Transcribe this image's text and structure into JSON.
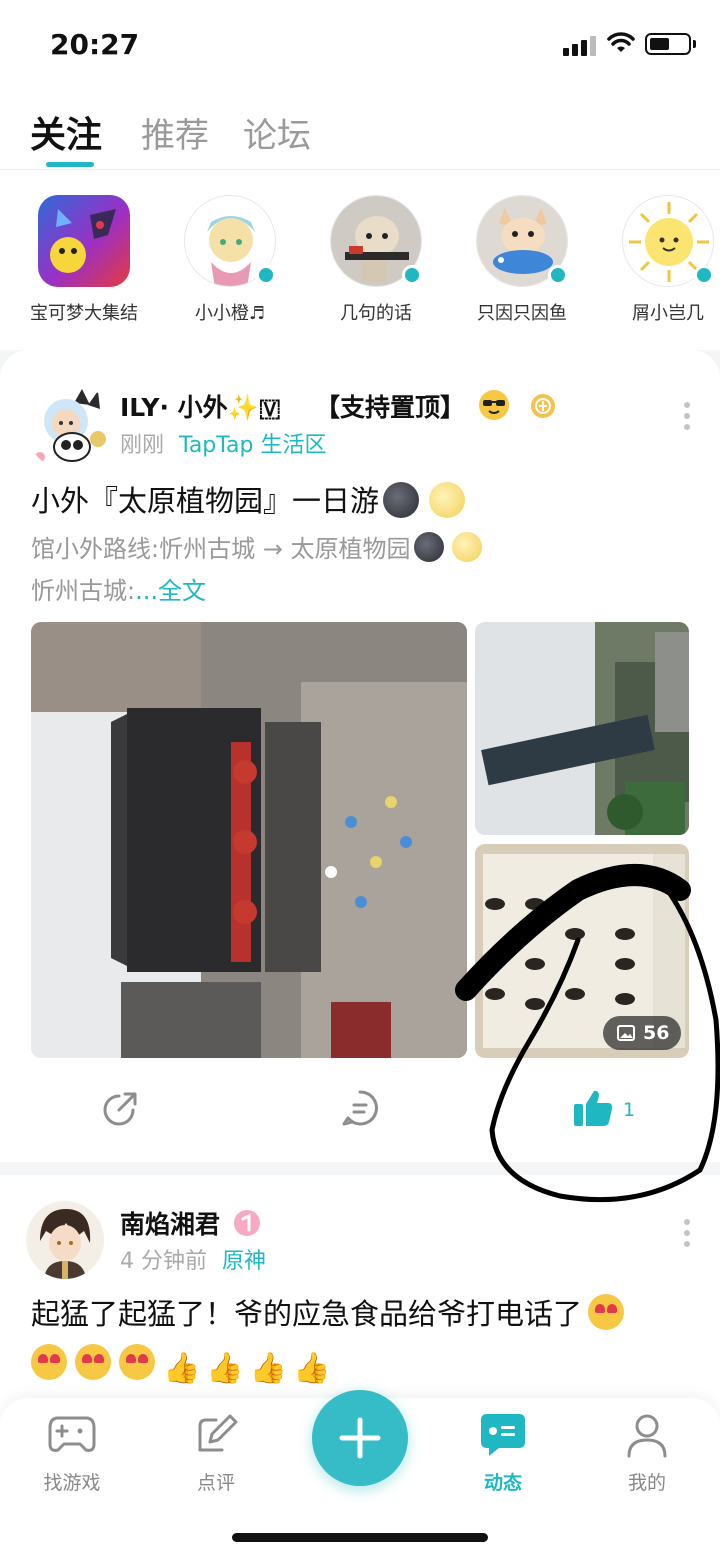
{
  "status_bar": {
    "time": "20:27"
  },
  "top_tabs": [
    {
      "label": "关注",
      "active": true
    },
    {
      "label": "推荐",
      "active": false
    },
    {
      "label": "论坛",
      "active": false
    }
  ],
  "following": [
    {
      "name": "宝可梦大集结",
      "shape": "square",
      "online": false
    },
    {
      "name": "小小橙♬",
      "shape": "round",
      "online": true
    },
    {
      "name": "几句的话",
      "shape": "round",
      "online": true
    },
    {
      "name": "只因只因鱼",
      "shape": "round",
      "online": true
    },
    {
      "name": "屑小岂几",
      "shape": "round",
      "online": true
    }
  ],
  "post1": {
    "author": "ILY· 小外✨🇻",
    "pin_tag": "【支持置顶】",
    "time": "刚刚",
    "source": "TapTap 生活区",
    "title": "小外『太原植物园』一日游",
    "excerpt_line1": "馆小外路线:忻州古城 → 太原植物园",
    "excerpt_line2_prefix": "忻州古城:",
    "read_more": "...全文",
    "photo_count": "56",
    "like_count": "1"
  },
  "post2": {
    "author": "南焰湘君",
    "time": "4 分钟前",
    "source": "原神",
    "text": "起猛了起猛了！爷的应急食品给爷打电话了"
  },
  "bottom_nav": [
    {
      "label": "找游戏",
      "icon": "gamepad-icon",
      "active": false
    },
    {
      "label": "点评",
      "icon": "review-pen-icon",
      "active": false
    },
    {
      "label": "动态",
      "icon": "feed-chat-icon",
      "active": true
    },
    {
      "label": "我的",
      "icon": "profile-icon",
      "active": false
    }
  ],
  "colors": {
    "accent": "#1fb8c2",
    "fab": "#35bcc6",
    "annotation": "#000000"
  }
}
